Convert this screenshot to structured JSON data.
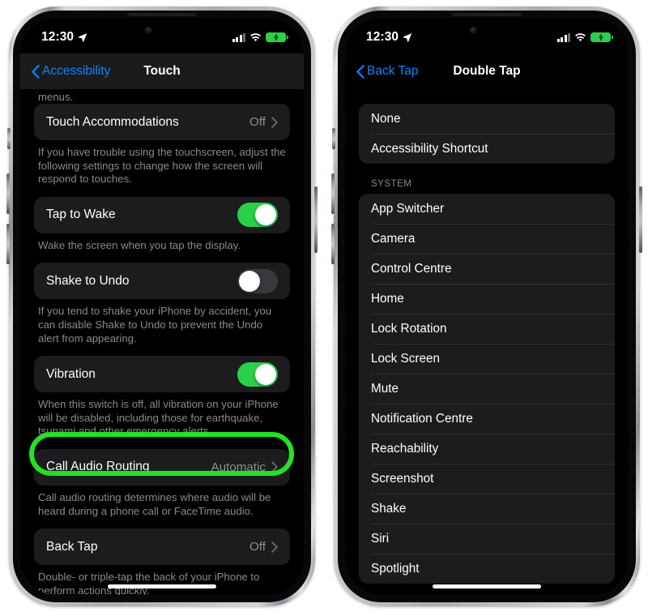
{
  "phones": [
    {
      "id": "touch-settings",
      "status_bar": {
        "time": "12:30",
        "location_icon": "location-arrow-icon",
        "signal_icon": "cellular-signal-icon",
        "wifi_icon": "wifi-icon",
        "battery_icon": "battery-charging-icon"
      },
      "nav": {
        "back_label": "Accessibility",
        "back_icon": "chevron-left-icon",
        "title": "Touch"
      },
      "scroll_stub": "menus.",
      "rows": [
        {
          "type": "disclosure",
          "label": "Touch Accommodations",
          "value": "Off",
          "chevron_icon": "chevron-right-icon",
          "footnote": "If you have trouble using the touchscreen, adjust the following settings to change how the screen will respond to touches."
        },
        {
          "type": "toggle",
          "label": "Tap to Wake",
          "state": "on",
          "footnote": "Wake the screen when you tap the display."
        },
        {
          "type": "toggle",
          "label": "Shake to Undo",
          "state": "off",
          "footnote": "If you tend to shake your iPhone by accident, you can disable Shake to Undo to prevent the Undo alert from appearing."
        },
        {
          "type": "toggle",
          "label": "Vibration",
          "state": "on",
          "footnote": "When this switch is off, all vibration on your iPhone will be disabled, including those for earthquake, tsunami and other emergency alerts."
        },
        {
          "type": "disclosure",
          "label": "Call Audio Routing",
          "value": "Automatic",
          "chevron_icon": "chevron-right-icon",
          "footnote": "Call audio routing determines where audio will be heard during a phone call or FaceTime audio."
        },
        {
          "type": "disclosure",
          "label": "Back Tap",
          "value": "Off",
          "chevron_icon": "chevron-right-icon",
          "highlighted": true,
          "footnote": "Double- or triple-tap the back of your iPhone to perform actions quickly."
        }
      ]
    },
    {
      "id": "double-tap-actions",
      "status_bar": {
        "time": "12:30",
        "location_icon": "location-arrow-icon",
        "signal_icon": "cellular-signal-icon",
        "wifi_icon": "wifi-icon",
        "battery_icon": "battery-charging-icon"
      },
      "nav": {
        "back_label": "Back Tap",
        "back_icon": "chevron-left-icon",
        "title": "Double Tap"
      },
      "top_group": [
        "None",
        "Accessibility Shortcut"
      ],
      "section_header": "SYSTEM",
      "system_items": [
        "App Switcher",
        "Camera",
        "Control Centre",
        "Home",
        "Lock Rotation",
        "Lock Screen",
        "Mute",
        "Notification Centre",
        "Reachability",
        "Screenshot",
        "Shake",
        "Siri",
        "Spotlight"
      ]
    }
  ],
  "colors": {
    "accent_blue": "#0a84ff",
    "toggle_on_green": "#2ad04a",
    "highlight_green": "#22e322",
    "card_background": "#1c1c1e",
    "screen_background": "#000000",
    "secondary_text": "#8a8a8e"
  }
}
